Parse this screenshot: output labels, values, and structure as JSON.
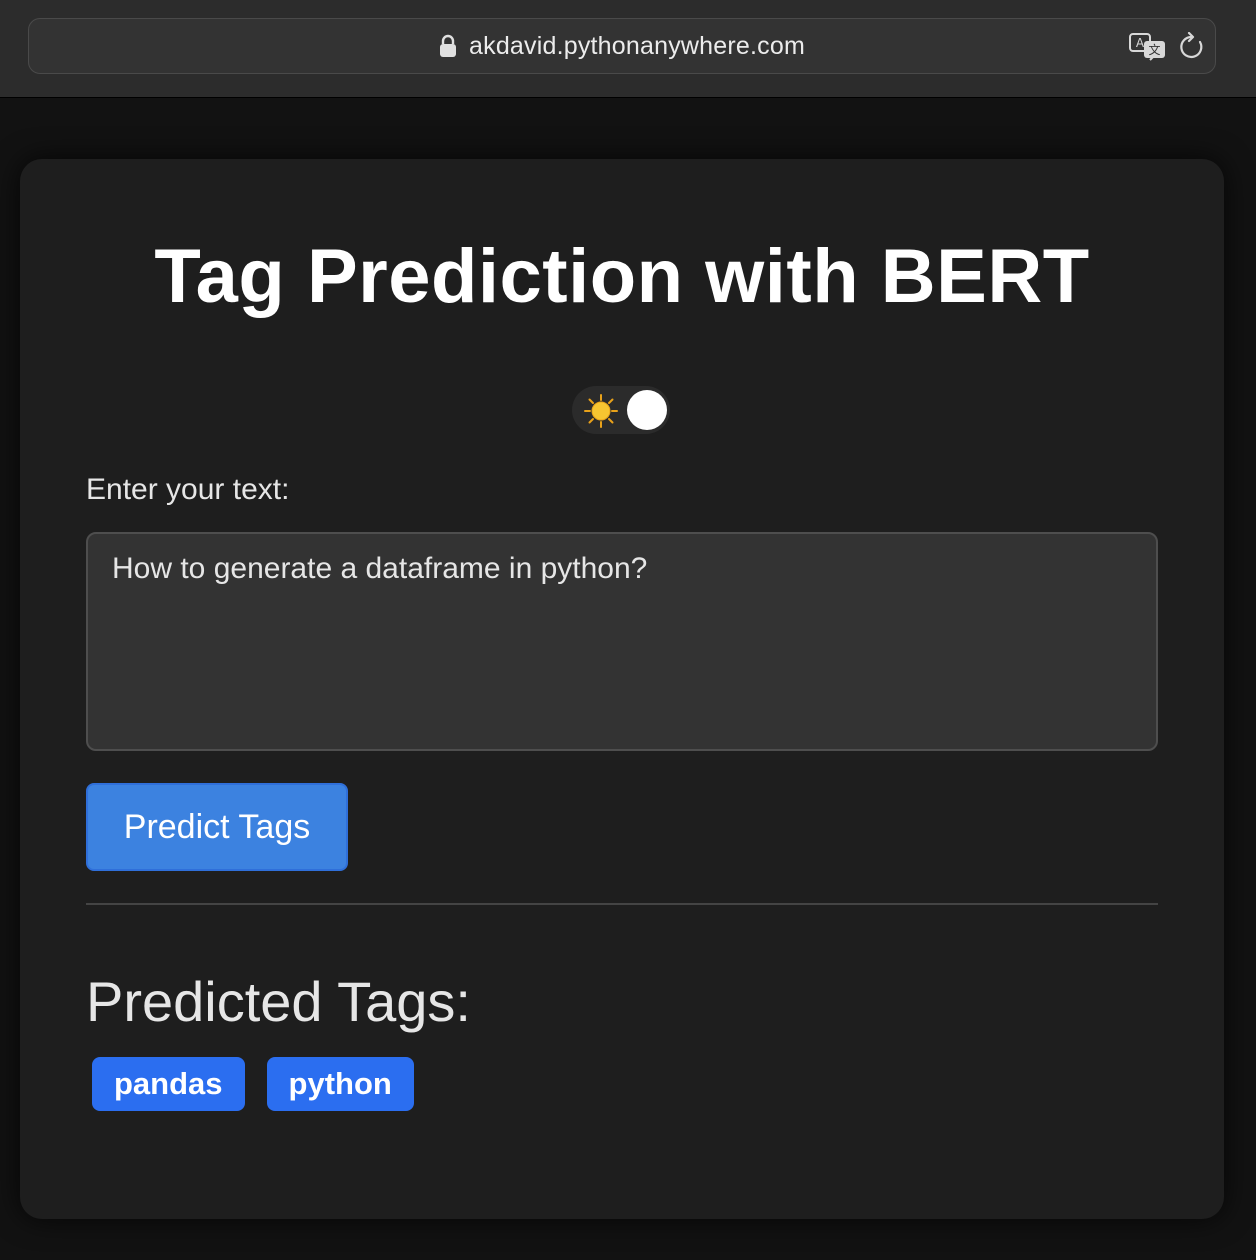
{
  "browser": {
    "url": "akdavid.pythonanywhere.com",
    "icons": {
      "lock": "lock-icon",
      "translate": "translate-icon",
      "reload": "reload-icon"
    }
  },
  "page": {
    "title": "Tag Prediction with BERT",
    "theme_toggle": {
      "icon": "sun-icon",
      "state": "dark"
    },
    "input": {
      "label": "Enter your text:",
      "value": "How to generate a dataframe in python?"
    },
    "predict_button_label": "Predict Tags",
    "results": {
      "heading": "Predicted Tags:",
      "tags": [
        "pandas",
        "python"
      ]
    }
  },
  "colors": {
    "background": "#121212",
    "card": "#1e1e1e",
    "button": "#3c82e0",
    "tag": "#2b6ef0",
    "text": "#e6e6e6"
  }
}
